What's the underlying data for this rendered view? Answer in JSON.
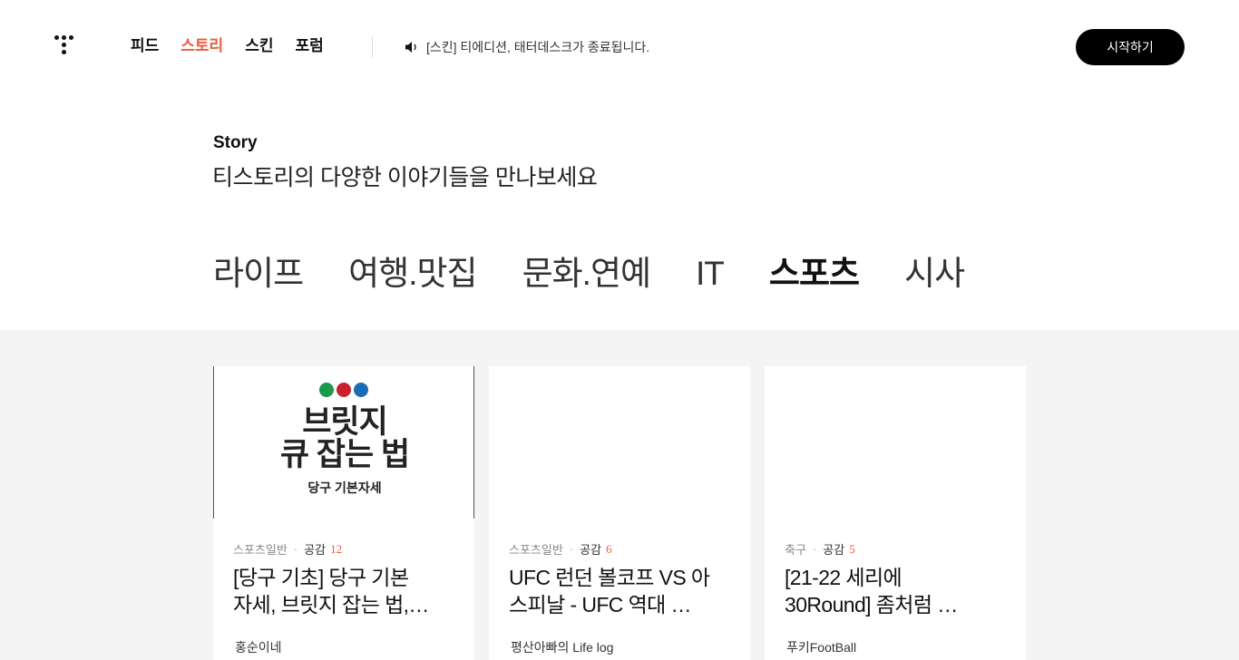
{
  "header": {
    "nav": [
      {
        "label": "피드",
        "active": false
      },
      {
        "label": "스토리",
        "active": true
      },
      {
        "label": "스킨",
        "active": false
      },
      {
        "label": "포럼",
        "active": false
      }
    ],
    "notice": "[스킨] 티에디션, 태터데스크가 종료됩니다.",
    "start_label": "시작하기"
  },
  "intro": {
    "label": "Story",
    "subtitle": "티스토리의 다양한 이야기들을 만나보세요"
  },
  "tabs": [
    {
      "label": "라이프",
      "active": false
    },
    {
      "label": "여행.맛집",
      "active": false
    },
    {
      "label": "문화.연예",
      "active": false
    },
    {
      "label": "IT",
      "active": false
    },
    {
      "label": "스포츠",
      "active": true
    },
    {
      "label": "시사",
      "active": false
    }
  ],
  "cards": [
    {
      "category": "스포츠일반",
      "like_label": "공감",
      "like_count": "12",
      "title_lines": [
        "[당구 기초] 당구 기본",
        "자세, 브릿지 잡는 법,…"
      ],
      "author": "홍순이네",
      "thumb": {
        "line1": "브릿지",
        "line2": "큐 잡는 법",
        "line3": "당구 기본자세",
        "circle_colors": [
          "#1a9a4a",
          "#c8202e",
          "#1a6db5"
        ]
      }
    },
    {
      "category": "스포츠일반",
      "like_label": "공감",
      "like_count": "6",
      "title_lines": [
        "UFC 런던 볼코프 VS 아",
        "스피날 - UFC 역대 …"
      ],
      "author": "평산아빠의 Life log"
    },
    {
      "category": "축구",
      "like_label": "공감",
      "like_count": "5",
      "title_lines": [
        "[21-22 세리에",
        "30Round] 좀처럼 …"
      ],
      "author": "푸키FootBall"
    }
  ],
  "colors": {
    "accent": "#ef5a3f",
    "content_bg": "#f4f4f4"
  }
}
